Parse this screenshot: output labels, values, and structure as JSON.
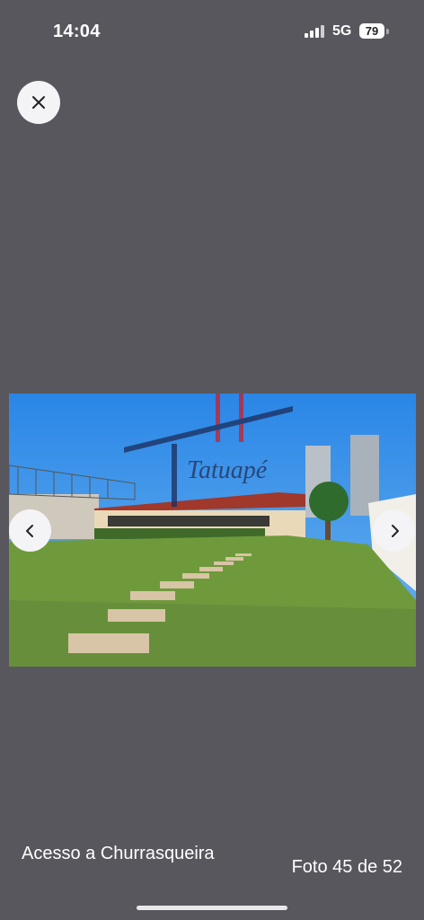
{
  "status_bar": {
    "time": "14:04",
    "network": "5G",
    "battery": "79",
    "signal_icon": "signal-bars-icon"
  },
  "viewer": {
    "close_icon": "close-icon",
    "prev_icon": "chevron-left-icon",
    "next_icon": "chevron-right-icon",
    "watermark": "Tatuapé",
    "caption": "Acesso a Churrasqueira",
    "counter": "Foto 45 de 52"
  },
  "colors": {
    "background": "#58575e",
    "sky": "#2f8fe8",
    "grass": "#6f9a3c",
    "watermark_red": "#c8202a",
    "watermark_navy": "#1c2c5a"
  }
}
